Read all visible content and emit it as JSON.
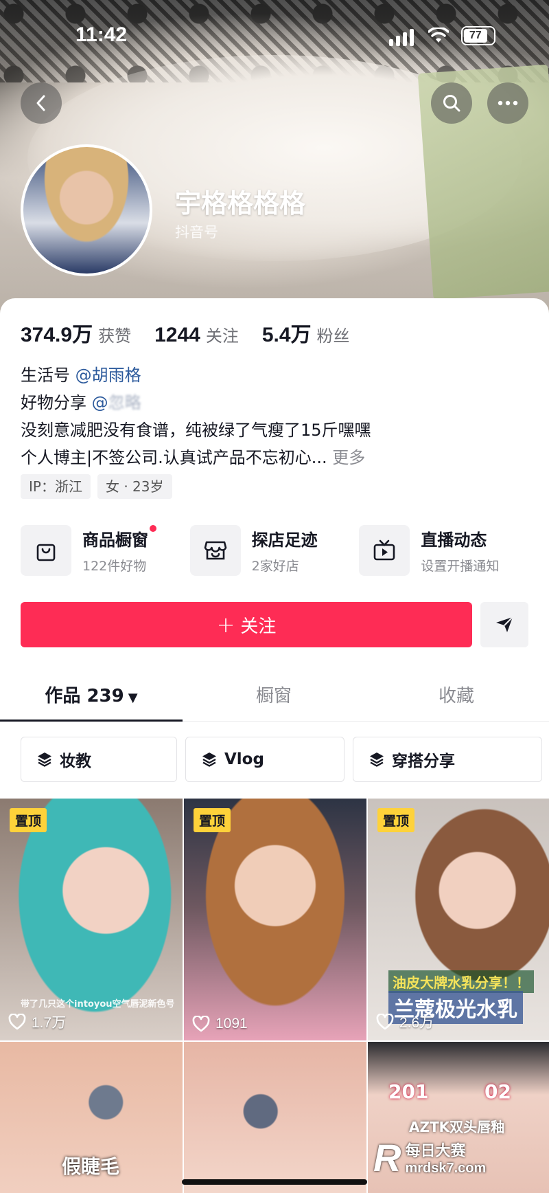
{
  "status_bar": {
    "time": "11:42",
    "battery": "77"
  },
  "profile": {
    "username": "宇格格格格",
    "id_label": "抖音号",
    "stats": [
      {
        "value": "374.9万",
        "label": "获赞"
      },
      {
        "value": "1244",
        "label": "关注"
      },
      {
        "value": "5.4万",
        "label": "粉丝"
      }
    ],
    "bio": {
      "line1_prefix": "生活号",
      "line1_mention": "@胡雨格",
      "line2_prefix": "好物分享",
      "line2_mention": "@忽略",
      "line3": "没刻意减肥没有食谱，纯被绿了气瘦了15斤嘿嘿",
      "line4": "个人博主|不签公司.认真试产品不忘初心...",
      "more": "更多"
    },
    "tags": [
      "IP：浙江",
      "女 · 23岁"
    ]
  },
  "features": [
    {
      "title": "商品橱窗",
      "subtitle": "122件好物",
      "icon": "shopping-bag-icon",
      "has_dot": true
    },
    {
      "title": "探店足迹",
      "subtitle": "2家好店",
      "icon": "store-icon",
      "has_dot": false
    },
    {
      "title": "直播动态",
      "subtitle": "设置开播通知",
      "icon": "tv-icon",
      "has_dot": false
    }
  ],
  "actions": {
    "follow_label": "关注",
    "follow_plus": "+"
  },
  "tabs": [
    {
      "label": "作品 239",
      "active": true,
      "caret": "▼"
    },
    {
      "label": "橱窗",
      "active": false
    },
    {
      "label": "收藏",
      "active": false
    }
  ],
  "collections": [
    "妆教",
    "Vlog",
    "穿搭分享"
  ],
  "videos": [
    {
      "pinned": true,
      "pin_label": "置顶",
      "likes": "1.7万",
      "caption": "带了几只这个intoyou空气唇泥新色号"
    },
    {
      "pinned": true,
      "pin_label": "置顶",
      "likes": "1091"
    },
    {
      "pinned": true,
      "pin_label": "置顶",
      "likes": "2.6万",
      "caption_top": "油皮大牌水乳分享！！",
      "caption_big": "兰蔻极光水乳"
    },
    {
      "caption_big": "假睫毛"
    },
    {},
    {
      "num1": "201",
      "num2": "02",
      "line": "AZTK双头唇釉"
    }
  ],
  "watermark": {
    "brand": "每日大赛",
    "site": "mrdsk7.com"
  },
  "colors": {
    "accent": "#fe2c55",
    "mention": "#2c5a9c",
    "pin": "#fed23a"
  }
}
